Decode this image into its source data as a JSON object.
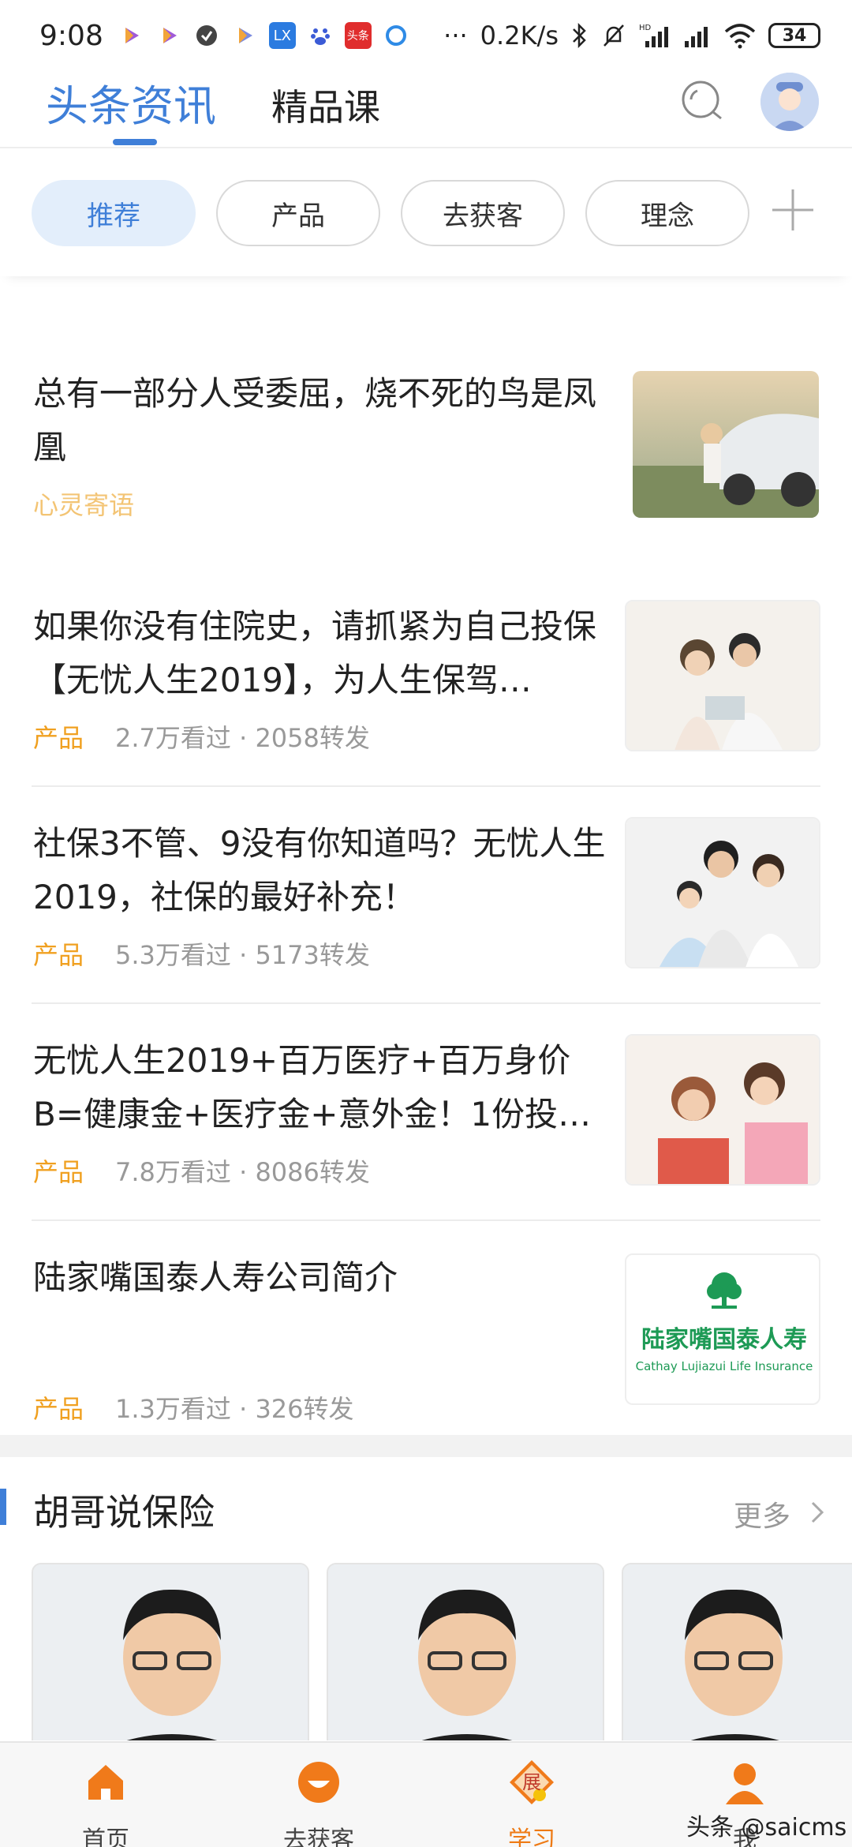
{
  "status_bar": {
    "time": "9:08",
    "network_speed": "0.2K/s",
    "battery": "34",
    "more": "···",
    "hd": "HD"
  },
  "header": {
    "tabs": [
      {
        "label": "头条资讯",
        "active": true
      },
      {
        "label": "精品课",
        "active": false
      }
    ],
    "icons": [
      "search-icon",
      "avatar"
    ]
  },
  "chips": [
    {
      "label": "推荐",
      "active": true
    },
    {
      "label": "产品",
      "active": false
    },
    {
      "label": "去获客",
      "active": false
    },
    {
      "label": "理念",
      "active": false
    }
  ],
  "feed": [
    {
      "title": "总有一部分人受委屈，烧不死的鸟是凤凰",
      "category": "心灵寄语",
      "views": "",
      "shares": ""
    },
    {
      "title": "如果你没有住院史，请抓紧为自己投保【无忧人生2019】，为人生保驾…",
      "category": "产品",
      "views": "2.7万看过",
      "shares": "· 2058转发"
    },
    {
      "title": "社保3不管、9没有你知道吗？无忧人生2019，社保的最好补充！",
      "category": "产品",
      "views": "5.3万看过",
      "shares": "· 5173转发"
    },
    {
      "title": "无忧人生2019+百万医疗+百万身价B=健康金+医疗金+意外金！1份投…",
      "category": "产品",
      "views": "7.8万看过",
      "shares": "· 8086转发"
    },
    {
      "title": "陆家嘴国泰人寿公司简介",
      "category": "产品",
      "views": "1.3万看过",
      "shares": "· 326转发"
    }
  ],
  "logo_text": {
    "cn": "陆家嘴国泰人寿",
    "en": "Cathay Lujiazui Life Insurance"
  },
  "section": {
    "title": "胡哥说保险",
    "more": "更多"
  },
  "tabbar": [
    {
      "label": "首页",
      "active": false
    },
    {
      "label": "去获客",
      "active": false
    },
    {
      "label": "学习",
      "active": true,
      "badge": "展"
    },
    {
      "label": "我",
      "active": false
    }
  ],
  "watermark": "头条 @saicms",
  "colors": {
    "accent": "#3f7fd8",
    "orange": "#ee7a14",
    "category": "#f0a020"
  }
}
